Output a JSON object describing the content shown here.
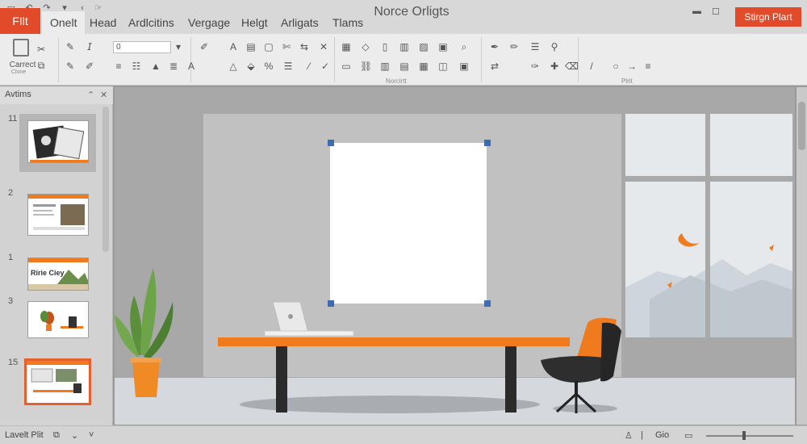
{
  "app": {
    "title": "Norce Orligts",
    "share_label": "Stirgn Plart"
  },
  "tabs": [
    {
      "label": "FIlt",
      "active": false
    },
    {
      "label": "Onelt",
      "active": true
    },
    {
      "label": "Head",
      "active": false
    },
    {
      "label": "Ardlcitins",
      "active": false
    },
    {
      "label": "Vergage",
      "active": false
    },
    {
      "label": "Helgt",
      "active": false
    },
    {
      "label": "Arligats",
      "active": false
    },
    {
      "label": "Tlams",
      "active": false
    }
  ],
  "ribbon": {
    "clipboard_label": "Carrect",
    "clipboard_sub": "Clone",
    "font_value": "0",
    "group_labels": [
      "Norcirtt",
      "Plrit"
    ]
  },
  "panel": {
    "title": "Avtims",
    "slides": [
      {
        "num": "11",
        "selected": false
      },
      {
        "num": "2",
        "selected": false
      },
      {
        "num": "1",
        "selected": false
      },
      {
        "num": "3",
        "selected": false
      },
      {
        "num": "15",
        "selected": true
      }
    ],
    "thumb_titles": [
      "Ririe Ciey"
    ]
  },
  "status": {
    "left_label": "Lavelt Plit",
    "right_label": "Gio"
  },
  "colors": {
    "accent": "#e24b2a",
    "orange": "#f07a1e",
    "handle": "#3d6db0"
  }
}
